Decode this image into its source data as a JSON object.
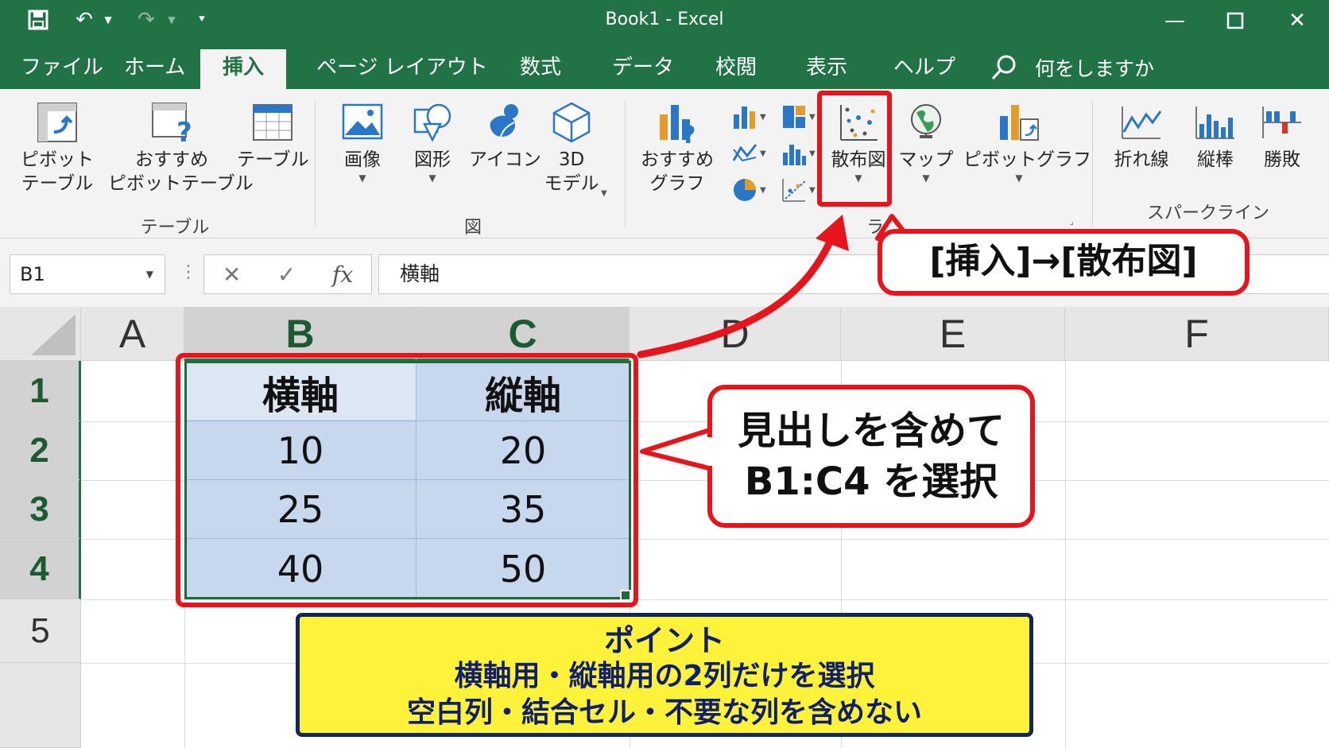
{
  "window": {
    "title": "Book1  -  Excel",
    "minimize_icon": "minimize-icon",
    "maximize_icon": "maximize-icon",
    "close_icon": "close-icon"
  },
  "qat": {
    "save_icon": "save-icon",
    "undo_icon": "undo-icon",
    "redo_icon": "redo-icon",
    "customize_icon": "customize-qat-icon"
  },
  "tabs": [
    {
      "label": "ファイル"
    },
    {
      "label": "ホーム"
    },
    {
      "label": "挿入",
      "active": true
    },
    {
      "label": "ページ レイアウト"
    },
    {
      "label": "数式"
    },
    {
      "label": "データ"
    },
    {
      "label": "校閲"
    },
    {
      "label": "表示"
    },
    {
      "label": "ヘルプ"
    }
  ],
  "tell_me": "何をしますか",
  "ribbon": {
    "pivot_table": "ピボット\nテーブル",
    "recommended_pivot": "おすすめ\nピボットテーブル",
    "table": "テーブル",
    "group_table": "テーブル",
    "image": "画像",
    "shapes": "図形",
    "icons": "アイコン",
    "model_3d": "3D\nモデル",
    "group_illustrations": "図",
    "recommended_charts": "おすすめ\nグラフ",
    "scatter": "散布図",
    "map": "マップ",
    "pivot_chart": "ピボットグラフ",
    "group_charts_partial": "ラ",
    "sparkline_line": "折れ線",
    "sparkline_column": "縦棒",
    "sparkline_winloss": "勝敗",
    "group_sparklines": "スパークライン"
  },
  "formula_bar": {
    "name_box": "B1",
    "cancel_symbol": "✕",
    "enter_symbol": "✓",
    "fx_label": "fx",
    "content": "横軸"
  },
  "sheet": {
    "columns": [
      "A",
      "B",
      "C",
      "D",
      "E",
      "F"
    ],
    "rows": [
      "1",
      "2",
      "3",
      "4",
      "5"
    ],
    "cells": {
      "B1": "横軸",
      "C1": "縦軸",
      "B2": "10",
      "C2": "20",
      "B3": "25",
      "C3": "35",
      "B4": "40",
      "C4": "50"
    }
  },
  "annotations": {
    "insert_callout": "[挿入]→[散布図]",
    "select_callout_line1": "見出しを含めて",
    "select_callout_line2": "B1:C4 を選択",
    "point_title": "ポイント",
    "point_line1": "横軸用・縦軸用の2列だけを選択",
    "point_line2": "空白列・結合セル・不要な列を含めない",
    "accent_red": "#e8141b",
    "note_yellow": "#fff23a",
    "note_navy": "#10265c"
  },
  "colors": {
    "excel_green": "#217346",
    "selection_fill": "#c6d7ee"
  }
}
